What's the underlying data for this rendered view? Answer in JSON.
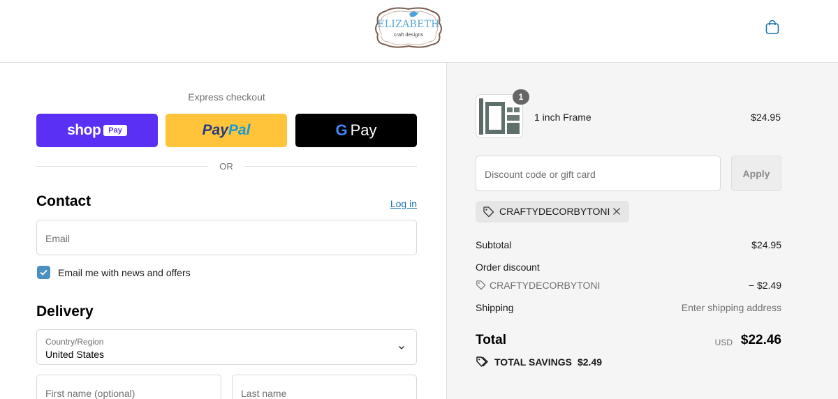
{
  "header": {
    "logo_text": "ELIZABETH",
    "logo_subtext": "craft designs"
  },
  "express": {
    "title": "Express checkout",
    "shop_word": "shop",
    "shop_pay": "Pay",
    "paypal_a": "Pay",
    "paypal_b": "Pal",
    "gpay_g": "G",
    "gpay_word": "Pay",
    "or": "OR"
  },
  "contact": {
    "title": "Contact",
    "login": "Log in",
    "email_placeholder": "Email",
    "newsletter_label": "Email me with news and offers",
    "newsletter_checked": true
  },
  "delivery": {
    "title": "Delivery",
    "country_label": "Country/Region",
    "country_value": "United States",
    "first_name_placeholder": "First name (optional)",
    "last_name_placeholder": "Last name"
  },
  "summary": {
    "item": {
      "name": "1 inch Frame",
      "price": "$24.95",
      "quantity": "1"
    },
    "discount_placeholder": "Discount code or gift card",
    "apply_label": "Apply",
    "applied_code": "CRAFTYDECORBYTONI",
    "subtotal_label": "Subtotal",
    "subtotal_value": "$24.95",
    "order_discount_label": "Order discount",
    "order_discount_code": "CRAFTYDECORBYTONI",
    "order_discount_value": "− $2.49",
    "shipping_label": "Shipping",
    "shipping_value": "Enter shipping address",
    "total_label": "Total",
    "total_currency": "USD",
    "total_value": "$22.46",
    "savings_label": "TOTAL SAVINGS",
    "savings_value": "$2.49"
  },
  "colors": {
    "shop_pay": "#5a31f4",
    "paypal": "#ffc439",
    "gpay": "#000000",
    "link": "#1773b0",
    "checkbox": "#4a90c2",
    "summary_bg": "#f5f5f5"
  }
}
